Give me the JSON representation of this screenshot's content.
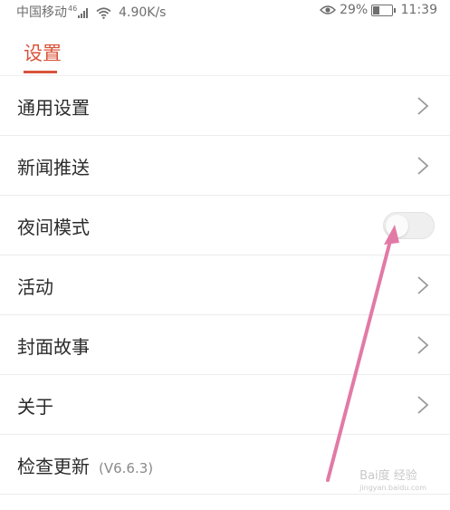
{
  "status_bar": {
    "carrier": "中国移动",
    "network_badge": "46",
    "speed": "4.90K/s",
    "battery": "29%",
    "time": "11:39"
  },
  "header": {
    "title": "设置"
  },
  "settings": {
    "items": [
      {
        "label": "通用设置",
        "control": "chevron"
      },
      {
        "label": "新闻推送",
        "control": "chevron"
      },
      {
        "label": "夜间模式",
        "control": "toggle",
        "enabled": false
      },
      {
        "label": "活动",
        "control": "chevron"
      },
      {
        "label": "封面故事",
        "control": "chevron"
      },
      {
        "label": "关于",
        "control": "chevron"
      },
      {
        "label": "检查更新",
        "version": "(V6.6.3)",
        "control": "none"
      }
    ]
  },
  "watermark": {
    "text": "Bai度 经验",
    "sub": "jingyan.baidu.com"
  },
  "colors": {
    "accent": "#d8553b",
    "annotation_arrow": "#e27aa6"
  }
}
